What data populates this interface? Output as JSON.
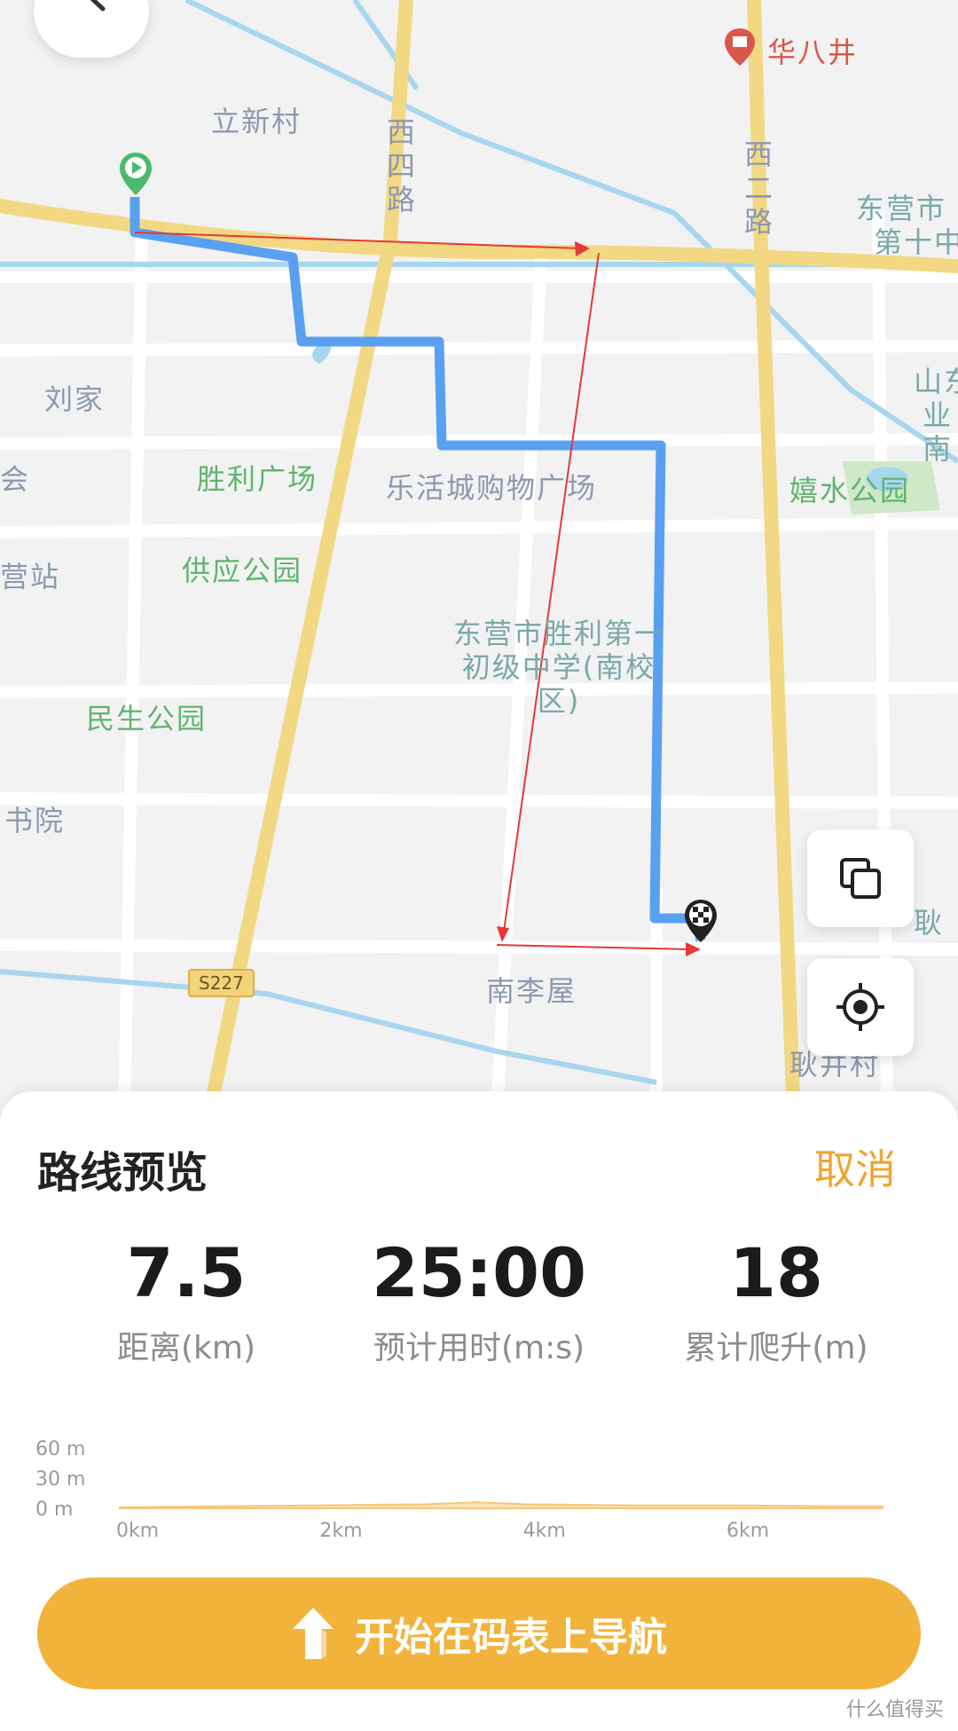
{
  "map": {
    "labels": {
      "lixincun": "立新村",
      "xisilu": "西四路",
      "huabajing": "华八井",
      "xierlu": "西二路",
      "dongying_top": "东营市",
      "dishi": "第十中",
      "liujia": "刘家",
      "hui": "会",
      "shengli_square": "胜利广场",
      "lehuo": "乐活城购物广场",
      "xishui_park": "嬉水公园",
      "shandong": "山东",
      "ye": "业",
      "nan": "南",
      "yingzhan": "营站",
      "gongying_park": "供应公园",
      "school": "东营市胜利第一初级中学(南校区)",
      "minsheng_park": "民生公园",
      "shuyuan": "书院",
      "nanliwu": "南李屋",
      "yaosheng": "耿",
      "gengjingcun": "耿井村",
      "road_shield": "S227"
    }
  },
  "panel": {
    "title": "路线预览",
    "cancel": "取消",
    "stats": [
      {
        "value": "7.5",
        "caption": "距离(km)"
      },
      {
        "value": "25:00",
        "caption": "预计用时(m:s)"
      },
      {
        "value": "18",
        "caption": "累计爬升(m)"
      }
    ],
    "elevation": {
      "y_ticks": [
        "60 m",
        "30 m",
        "0 m"
      ],
      "x_ticks": [
        "0km",
        "2km",
        "4km",
        "6km"
      ]
    },
    "nav_button": "开始在码表上导航"
  },
  "chart_data": {
    "type": "area",
    "xlabel": "",
    "ylabel": "",
    "x_unit": "km",
    "y_unit": "m",
    "ylim": [
      0,
      60
    ],
    "xlim": [
      0,
      7.5
    ],
    "x": [
      0,
      1,
      2,
      3,
      3.5,
      4,
      5,
      6,
      7,
      7.5
    ],
    "y": [
      1,
      2,
      3,
      4,
      6,
      4,
      3,
      3,
      2,
      2
    ]
  },
  "watermark": "什么值得买",
  "colors": {
    "accent": "#f2b33d",
    "route": "#5aa0f0",
    "cancel": "#f0a431"
  }
}
